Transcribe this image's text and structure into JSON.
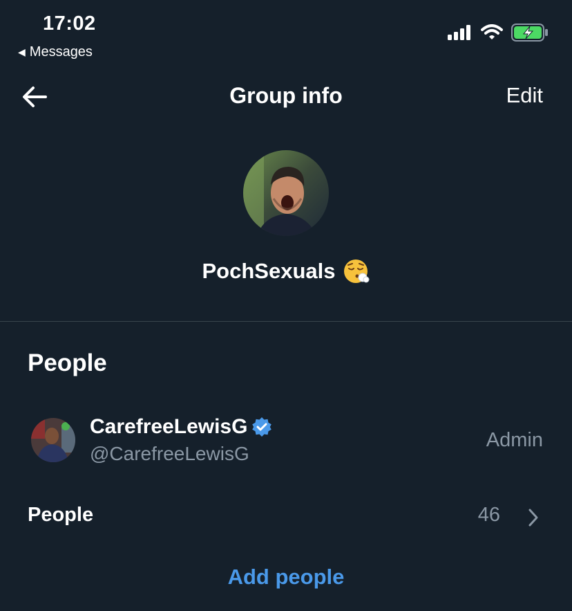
{
  "status_bar": {
    "time": "17:02",
    "back_app": "Messages"
  },
  "header": {
    "title": "Group info",
    "edit_label": "Edit"
  },
  "group": {
    "name": "PochSexuals",
    "emoji": "😮‍💨"
  },
  "people_section": {
    "title": "People",
    "members": [
      {
        "display_name": "CarefreeLewisG",
        "handle": "@CarefreeLewisG",
        "role": "Admin",
        "verified": true
      }
    ],
    "people_row_label": "People",
    "people_count": "46",
    "add_people_label": "Add people"
  },
  "colors": {
    "background": "#15202b",
    "accent": "#4a99e9",
    "secondary_text": "#8b98a5",
    "divider": "#38444d",
    "battery_green": "#4cd964"
  },
  "icons": {
    "back": "arrow-left-icon",
    "verified": "verified-badge-icon",
    "chevron": "chevron-right-icon",
    "signal": "cellular-signal-icon",
    "wifi": "wifi-icon",
    "battery": "battery-charging-icon"
  }
}
